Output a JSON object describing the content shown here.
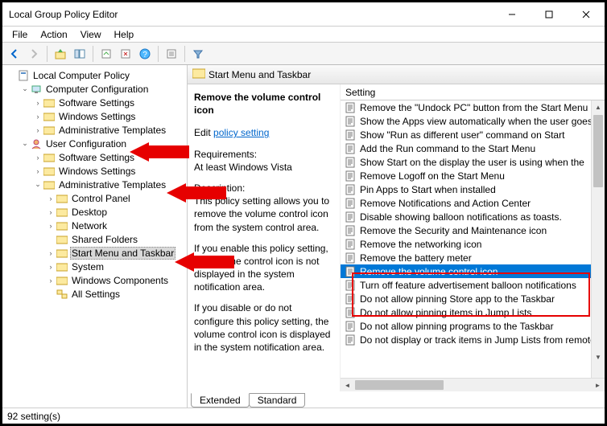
{
  "titlebar": {
    "title": "Local Group Policy Editor"
  },
  "menubar": {
    "items": [
      "File",
      "Action",
      "View",
      "Help"
    ]
  },
  "tree": {
    "root": "Local Computer Policy",
    "computer": {
      "label": "Computer Configuration",
      "children": [
        "Software Settings",
        "Windows Settings",
        "Administrative Templates"
      ]
    },
    "user": {
      "label": "User Configuration",
      "children": {
        "software": "Software Settings",
        "windows": "Windows Settings",
        "admin": {
          "label": "Administrative Templates",
          "children": [
            "Control Panel",
            "Desktop",
            "Network",
            "Shared Folders",
            "Start Menu and Taskbar",
            "System",
            "Windows Components",
            "All Settings"
          ]
        }
      }
    }
  },
  "header": {
    "title": "Start Menu and Taskbar"
  },
  "desc": {
    "heading": "Remove the volume control icon",
    "edit_label": "Edit",
    "edit_link": "policy setting",
    "req_label": "Requirements:",
    "req_value": "At least Windows Vista",
    "desc_label": "Description:",
    "para1": "This policy setting allows you to remove the volume control icon from the system control area.",
    "para2": "If you enable this policy setting, the volume control icon is not displayed in the system notification area.",
    "para3": "If you disable or do not configure this policy setting, the volume control icon is displayed in the system notification area."
  },
  "list": {
    "column": "Setting",
    "items": [
      "Remove the \"Undock PC\" button from the Start Menu",
      "Show the Apps view automatically when the user goes",
      "Show \"Run as different user\" command on Start",
      "Add the Run command to the Start Menu",
      "Show Start on the display the user is using when the",
      "Remove Logoff on the Start Menu",
      "Pin Apps to Start when installed",
      "Remove Notifications and Action Center",
      "Disable showing balloon notifications as toasts.",
      "Remove the Security and Maintenance icon",
      "Remove the networking icon",
      "Remove the battery meter",
      "Remove the volume control icon",
      "Turn off feature advertisement balloon notifications",
      "Do not allow pinning Store app to the Taskbar",
      "Do not allow pinning items in Jump Lists",
      "Do not allow pinning programs to the Taskbar",
      "Do not display or track items in Jump Lists from remote"
    ],
    "selected_index": 12
  },
  "tabs": {
    "extended": "Extended",
    "standard": "Standard"
  },
  "statusbar": {
    "text": "92 setting(s)"
  }
}
